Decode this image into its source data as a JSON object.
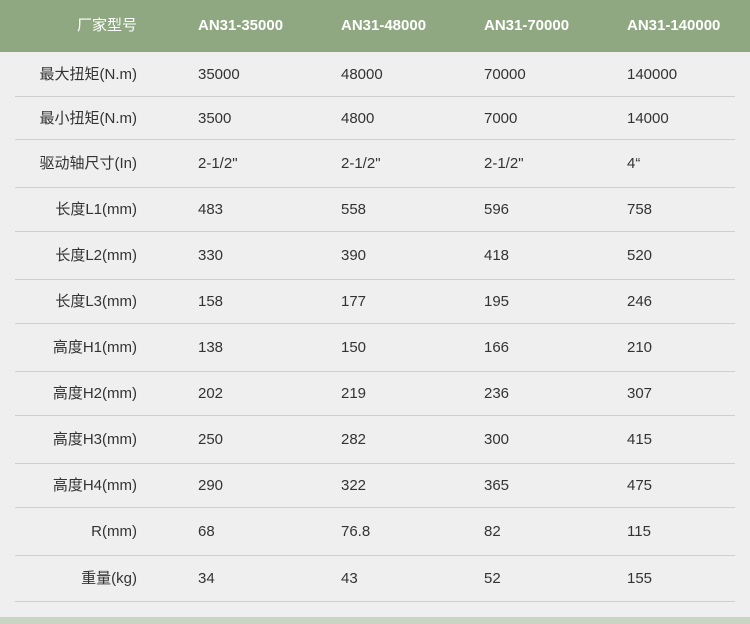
{
  "table": {
    "header": {
      "label": "厂家型号",
      "models": [
        "AN31-35000",
        "AN31-48000",
        "AN31-70000",
        "AN31-140000"
      ]
    },
    "rows": [
      {
        "label": "最大扭矩(N.m)",
        "values": [
          "35000",
          "48000",
          "70000",
          "140000"
        ]
      },
      {
        "label": "最小扭矩(N.m)",
        "values": [
          "3500",
          "4800",
          "7000",
          "14000"
        ]
      },
      {
        "label": "驱动轴尺寸(In)",
        "values": [
          "2-1/2\"",
          "2-1/2\"",
          "2-1/2\"",
          "4“"
        ]
      },
      {
        "label": "长度L1(mm)",
        "values": [
          "483",
          "558",
          "596",
          "758"
        ]
      },
      {
        "label": "长度L2(mm)",
        "values": [
          "330",
          "390",
          "418",
          "520"
        ]
      },
      {
        "label": "长度L3(mm)",
        "values": [
          "158",
          "177",
          "195",
          "246"
        ]
      },
      {
        "label": "高度H1(mm)",
        "values": [
          "138",
          "150",
          "166",
          "210"
        ]
      },
      {
        "label": "高度H2(mm)",
        "values": [
          "202",
          "219",
          "236",
          "307"
        ]
      },
      {
        "label": "高度H3(mm)",
        "values": [
          "250",
          "282",
          "300",
          "415"
        ]
      },
      {
        "label": "高度H4(mm)",
        "values": [
          "290",
          "322",
          "365",
          "475"
        ]
      },
      {
        "label": "R(mm)",
        "values": [
          "68",
          "76.8",
          "82",
          "115"
        ]
      },
      {
        "label": "重量(kg)",
        "values": [
          "34",
          "43",
          "52",
          "155"
        ]
      }
    ]
  },
  "colors": {
    "header_bg": "#8fa882",
    "header_text": "#ffffff",
    "body_bg": "#efefef",
    "row_line": "#cfcfcf",
    "bottom_bar": "#c8d5c2"
  }
}
